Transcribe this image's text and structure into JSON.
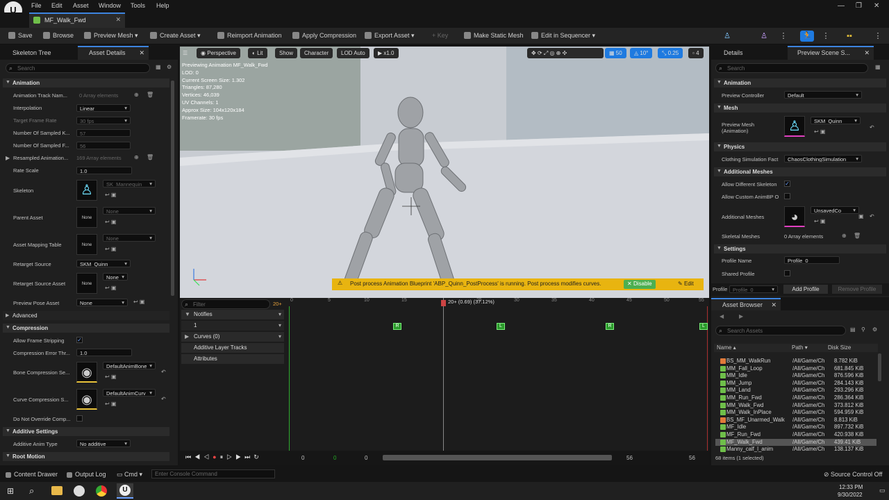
{
  "menubar": {
    "items": [
      "File",
      "Edit",
      "Asset",
      "Window",
      "Tools",
      "Help"
    ]
  },
  "doc_tab": {
    "label": "MF_Walk_Fwd"
  },
  "toolbar": {
    "save": "Save",
    "browse": "Browse",
    "preview_mesh": "Preview Mesh",
    "create_asset": "Create Asset",
    "reimport": "Reimport Animation",
    "apply_compression": "Apply Compression",
    "export_asset": "Export Asset",
    "key": "Key",
    "make_static_mesh": "Make Static Mesh",
    "edit_in_sequencer": "Edit in Sequencer"
  },
  "left_panel": {
    "tabs": [
      "Skeleton Tree",
      "Asset Details"
    ],
    "search_placeholder": "Search",
    "sections": {
      "animation": "Animation",
      "advanced": "Advanced",
      "compression": "Compression",
      "additive": "Additive Settings",
      "root_motion": "Root Motion"
    },
    "props": {
      "anim_track_name": {
        "label": "Animation Track Nam...",
        "value": "0 Array elements"
      },
      "interpolation": {
        "label": "Interpolation",
        "value": "Linear"
      },
      "target_frame_rate": {
        "label": "Target Frame Rate",
        "value": "30 fps"
      },
      "num_sampled_k": {
        "label": "Number Of Sampled K...",
        "value": "57"
      },
      "num_sampled_f": {
        "label": "Number Of Sampled F...",
        "value": "56"
      },
      "resampled": {
        "label": "Resampled Animation...",
        "value": "169 Array elements"
      },
      "rate_scale": {
        "label": "Rate Scale",
        "value": "1.0"
      },
      "skeleton": {
        "label": "Skeleton",
        "value": "SK_Mannequin"
      },
      "parent_asset": {
        "label": "Parent Asset",
        "value": "None",
        "thumb": "None"
      },
      "asset_mapping": {
        "label": "Asset Mapping Table",
        "value": "None",
        "thumb": "None"
      },
      "retarget_source": {
        "label": "Retarget Source",
        "value": "SKM_Quinn"
      },
      "retarget_source_asset": {
        "label": "Retarget Source Asset",
        "value": "None",
        "thumb": "None"
      },
      "preview_pose": {
        "label": "Preview Pose Asset",
        "value": "None"
      },
      "allow_frame_strip": {
        "label": "Allow Frame Stripping"
      },
      "compression_error": {
        "label": "Compression Error Thr...",
        "value": "1.0"
      },
      "bone_compression": {
        "label": "Bone Compression Se...",
        "value": "DefaultAnimBone"
      },
      "curve_compression": {
        "label": "Curve Compression S...",
        "value": "DefaultAnimCurv"
      },
      "do_not_override": {
        "label": "Do Not Override Comp..."
      },
      "additive_anim_type": {
        "label": "Additive Anim Type",
        "value": "No additive"
      }
    }
  },
  "viewport": {
    "perspective": "Perspective",
    "lit": "Lit",
    "show": "Show",
    "character": "Character",
    "lod": "LOD Auto",
    "speed": "x1.0",
    "right_nums": [
      "50",
      "10°",
      "0.25",
      "4"
    ],
    "stats": [
      "Previewing Animation MF_Walk_Fwd",
      "LOD: 0",
      "Current Screen Size: 1.302",
      "Triangles: 87,280",
      "Vertices: 46,039",
      "UV Channels: 1",
      "Approx Size: 104x120x184",
      "Framerate: 30 fps"
    ],
    "warning": "Post process Animation Blueprint 'ABP_Quinn_PostProcess' is running. Post process modifies curves.",
    "disable": "Disable",
    "edit": "Edit"
  },
  "sequencer": {
    "filter_placeholder": "Filter",
    "fps": "20+",
    "tracks": {
      "notifies": "Notifies",
      "one": "1",
      "curves": "Curves",
      "curves_count": "(0)",
      "additive": "Additive Layer Tracks",
      "attributes": "Attributes"
    },
    "playhead": "20+ (0.69) (37.12%)",
    "ticks": [
      "0",
      "5",
      "10",
      "15",
      "20",
      "25",
      "30",
      "35",
      "40",
      "45",
      "50",
      "55"
    ],
    "bottom_nums": [
      "0",
      "0",
      "0",
      "56",
      "56"
    ]
  },
  "details": {
    "tabs": [
      "Details",
      "Preview Scene S..."
    ],
    "search_placeholder": "Search",
    "sections": {
      "animation": "Animation",
      "mesh": "Mesh",
      "physics": "Physics",
      "additional": "Additional Meshes",
      "settings": "Settings"
    },
    "preview_controller": {
      "label": "Preview Controller",
      "value": "Default"
    },
    "preview_mesh": {
      "label": "Preview Mesh (Animation)",
      "value": "SKM_Quinn"
    },
    "clothing": {
      "label": "Clothing Simulation Fact",
      "value": "ChaosClothingSimulation"
    },
    "allow_diff_skel": {
      "label": "Allow Different Skeleton"
    },
    "allow_custom_anim": {
      "label": "Allow Custom AnimBP O"
    },
    "additional_meshes": {
      "label": "Additional Meshes",
      "value": "UnsavedCo"
    },
    "skeletal_meshes": {
      "label": "Skeletal Meshes",
      "value": "0 Array elements"
    },
    "profile_name": {
      "label": "Profile Name",
      "value": "Profile_0"
    },
    "shared_profile": {
      "label": "Shared Profile"
    },
    "profile_bar": {
      "label": "Profile",
      "value": "Profile_0",
      "add": "Add Profile",
      "remove": "Remove Profile"
    }
  },
  "asset_browser": {
    "tab": "Asset Browser",
    "search_placeholder": "Search Assets",
    "headers": {
      "name": "Name",
      "path": "Path",
      "size": "Disk Size"
    },
    "rows": [
      {
        "name": "BS_MM_WalkRun",
        "path": "/All/Game/Ch",
        "size": "8.782 KiB",
        "color": "#e07a3a"
      },
      {
        "name": "MM_Fall_Loop",
        "path": "/All/Game/Ch",
        "size": "681.845 KiB",
        "color": "#6fbf4a"
      },
      {
        "name": "MM_Idle",
        "path": "/All/Game/Ch",
        "size": "876.596 KiB",
        "color": "#6fbf4a"
      },
      {
        "name": "MM_Jump",
        "path": "/All/Game/Ch",
        "size": "284.143 KiB",
        "color": "#6fbf4a"
      },
      {
        "name": "MM_Land",
        "path": "/All/Game/Ch",
        "size": "293.296 KiB",
        "color": "#6fbf4a"
      },
      {
        "name": "MM_Run_Fwd",
        "path": "/All/Game/Ch",
        "size": "286.364 KiB",
        "color": "#6fbf4a"
      },
      {
        "name": "MM_Walk_Fwd",
        "path": "/All/Game/Ch",
        "size": "373.812 KiB",
        "color": "#6fbf4a"
      },
      {
        "name": "MM_Walk_InPlace",
        "path": "/All/Game/Ch",
        "size": "594.959 KiB",
        "color": "#6fbf4a"
      },
      {
        "name": "BS_MF_Unarmed_Walk",
        "path": "/All/Game/Ch",
        "size": "8.813 KiB",
        "color": "#e07a3a"
      },
      {
        "name": "MF_Idle",
        "path": "/All/Game/Ch",
        "size": "897.732 KiB",
        "color": "#6fbf4a"
      },
      {
        "name": "MF_Run_Fwd",
        "path": "/All/Game/Ch",
        "size": "420.938 KiB",
        "color": "#6fbf4a"
      },
      {
        "name": "MF_Walk_Fwd",
        "path": "/All/Game/Ch",
        "size": "439.41 KiB",
        "color": "#6fbf4a"
      },
      {
        "name": "Manny_calf_l_anim",
        "path": "/All/Game/Ch",
        "size": "138.137 KiB",
        "color": "#6fbf4a"
      }
    ],
    "footer": "68 items (1 selected)"
  },
  "bottom": {
    "content_drawer": "Content Drawer",
    "output_log": "Output Log",
    "cmd": "Cmd",
    "console_placeholder": "Enter Console Command",
    "source_control": "Source Control Off"
  },
  "taskbar": {
    "time": "12:33 PM",
    "date": "9/30/2022"
  }
}
